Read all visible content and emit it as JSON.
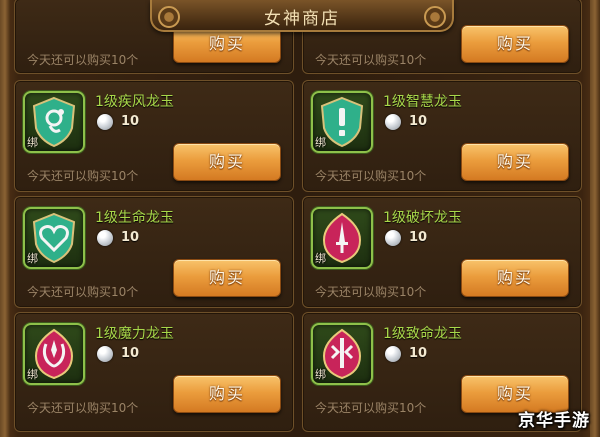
{
  "header": {
    "title": "女神商店"
  },
  "labels": {
    "buy": "购买",
    "bound": "绑",
    "limit_text": "今天还可以购买10个"
  },
  "items": [
    {
      "name": "",
      "price": "",
      "icon": "partial-top-left"
    },
    {
      "name": "",
      "price": "",
      "icon": "partial-top-right"
    },
    {
      "name": "1级疾风龙玉",
      "price": "10",
      "icon": "wind-jade-icon"
    },
    {
      "name": "1级智慧龙玉",
      "price": "10",
      "icon": "wisdom-jade-icon"
    },
    {
      "name": "1级生命龙玉",
      "price": "10",
      "icon": "life-jade-icon"
    },
    {
      "name": "1级破坏龙玉",
      "price": "10",
      "icon": "destruction-jade-icon"
    },
    {
      "name": "1级魔力龙玉",
      "price": "10",
      "icon": "magic-jade-icon"
    },
    {
      "name": "1级致命龙玉",
      "price": "10",
      "icon": "lethal-jade-icon"
    }
  ],
  "currency_icon": "silver-coin-icon",
  "colors": {
    "item_name": "#a8d84a",
    "button": "#eb9d3d",
    "limit_text": "#9a8366",
    "green_gem": "#2fb08a",
    "red_gem": "#c8245a"
  },
  "watermark": "京华手游"
}
